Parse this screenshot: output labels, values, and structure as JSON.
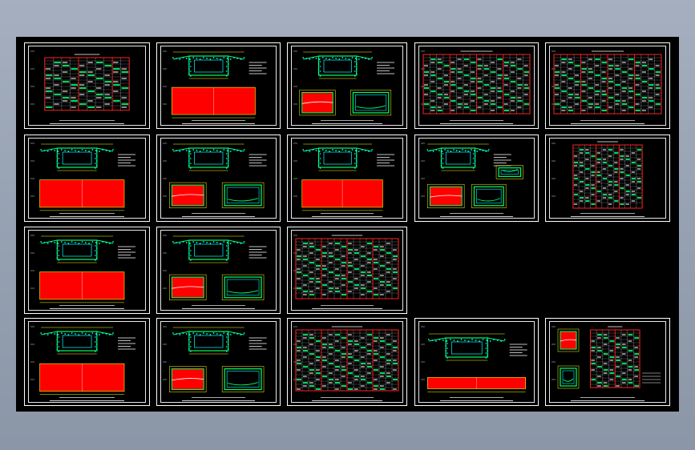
{
  "window": {
    "title": ""
  },
  "colors": {
    "frame": "#ffffff",
    "red_fill": "#ff0000",
    "green": "#00ff66",
    "cyan": "#00ffff",
    "yellow": "#ffff00",
    "table_red": "#ff2020"
  },
  "sheets": [
    {
      "id": "s1",
      "kind": "table-small"
    },
    {
      "id": "s2",
      "kind": "section-redblock"
    },
    {
      "id": "s3",
      "kind": "section-two-boxes"
    },
    {
      "id": "s4",
      "kind": "table-full"
    },
    {
      "id": "s5",
      "kind": "table-full"
    },
    {
      "id": "s6",
      "kind": "section-redblock"
    },
    {
      "id": "s7",
      "kind": "section-two-boxes"
    },
    {
      "id": "s8",
      "kind": "section-redblock"
    },
    {
      "id": "s9",
      "kind": "section-two-boxes-small"
    },
    {
      "id": "s10",
      "kind": "table-narrow"
    },
    {
      "id": "s11",
      "kind": "section-redblock"
    },
    {
      "id": "s12",
      "kind": "section-two-boxes"
    },
    {
      "id": "s13",
      "kind": "table-full"
    },
    {
      "id": "s14",
      "kind": "section-redblock"
    },
    {
      "id": "s15",
      "kind": "section-two-boxes"
    },
    {
      "id": "s16",
      "kind": "table-full"
    },
    {
      "id": "s17",
      "kind": "section-redstrip"
    },
    {
      "id": "s18",
      "kind": "table-with-details"
    }
  ]
}
